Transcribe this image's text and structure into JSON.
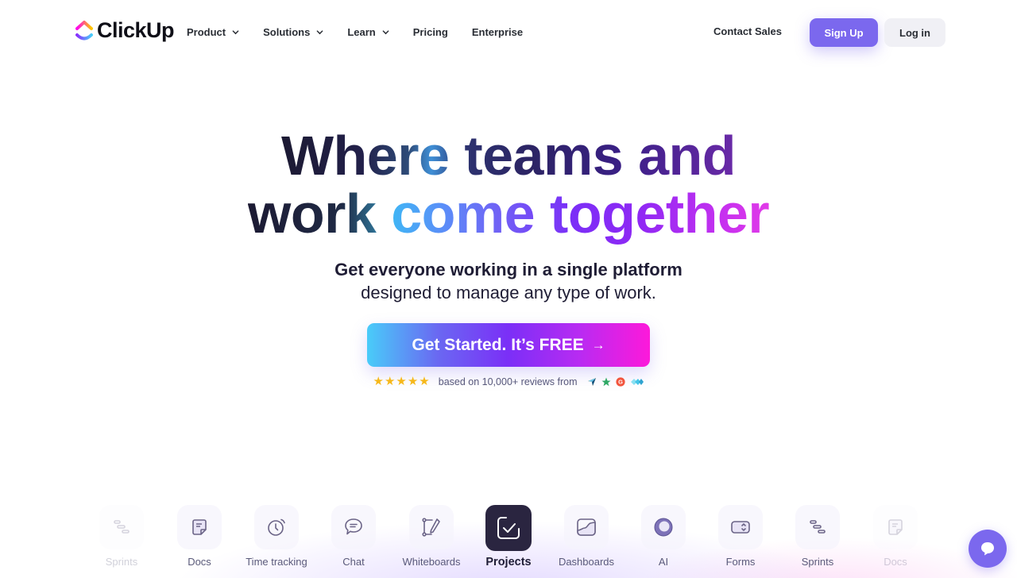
{
  "header": {
    "brand": "ClickUp",
    "nav": [
      {
        "label": "Product",
        "has_dropdown": true
      },
      {
        "label": "Solutions",
        "has_dropdown": true
      },
      {
        "label": "Learn",
        "has_dropdown": true
      },
      {
        "label": "Pricing",
        "has_dropdown": false
      },
      {
        "label": "Enterprise",
        "has_dropdown": false
      }
    ],
    "contact_sales": "Contact Sales",
    "sign_up": "Sign Up",
    "log_in": "Log in"
  },
  "hero": {
    "title_line1": "Where teams and",
    "title_line2": "work come together",
    "subtitle_bold": "Get everyone working in a single platform",
    "subtitle_regular": "designed to manage any type of work.",
    "cta_label": "Get Started. It’s FREE",
    "cta_arrow": "→",
    "rating_stars": 5,
    "reviews_text": "based on 10,000+ reviews from",
    "review_sources": [
      "capterra-icon",
      "trustpilot-icon",
      "g2-icon",
      "getapp-icon"
    ]
  },
  "features": [
    {
      "label": "Sprints",
      "icon": "sprints-icon",
      "state": "faded"
    },
    {
      "label": "Docs",
      "icon": "docs-icon",
      "state": "normal"
    },
    {
      "label": "Time tracking",
      "icon": "clock-icon",
      "state": "normal"
    },
    {
      "label": "Chat",
      "icon": "chat-icon",
      "state": "normal"
    },
    {
      "label": "Whiteboards",
      "icon": "whiteboard-icon",
      "state": "normal"
    },
    {
      "label": "Projects",
      "icon": "checkbox-icon",
      "state": "active"
    },
    {
      "label": "Dashboards",
      "icon": "dashboard-icon",
      "state": "normal"
    },
    {
      "label": "AI",
      "icon": "ai-icon",
      "state": "normal"
    },
    {
      "label": "Forms",
      "icon": "forms-icon",
      "state": "normal"
    },
    {
      "label": "Sprints",
      "icon": "sprints-icon",
      "state": "normal"
    },
    {
      "label": "Docs",
      "icon": "docs-icon",
      "state": "faded"
    }
  ],
  "colors": {
    "brand_purple": "#7b68ee",
    "star": "#f6b81a",
    "text_dark": "#292d34"
  }
}
